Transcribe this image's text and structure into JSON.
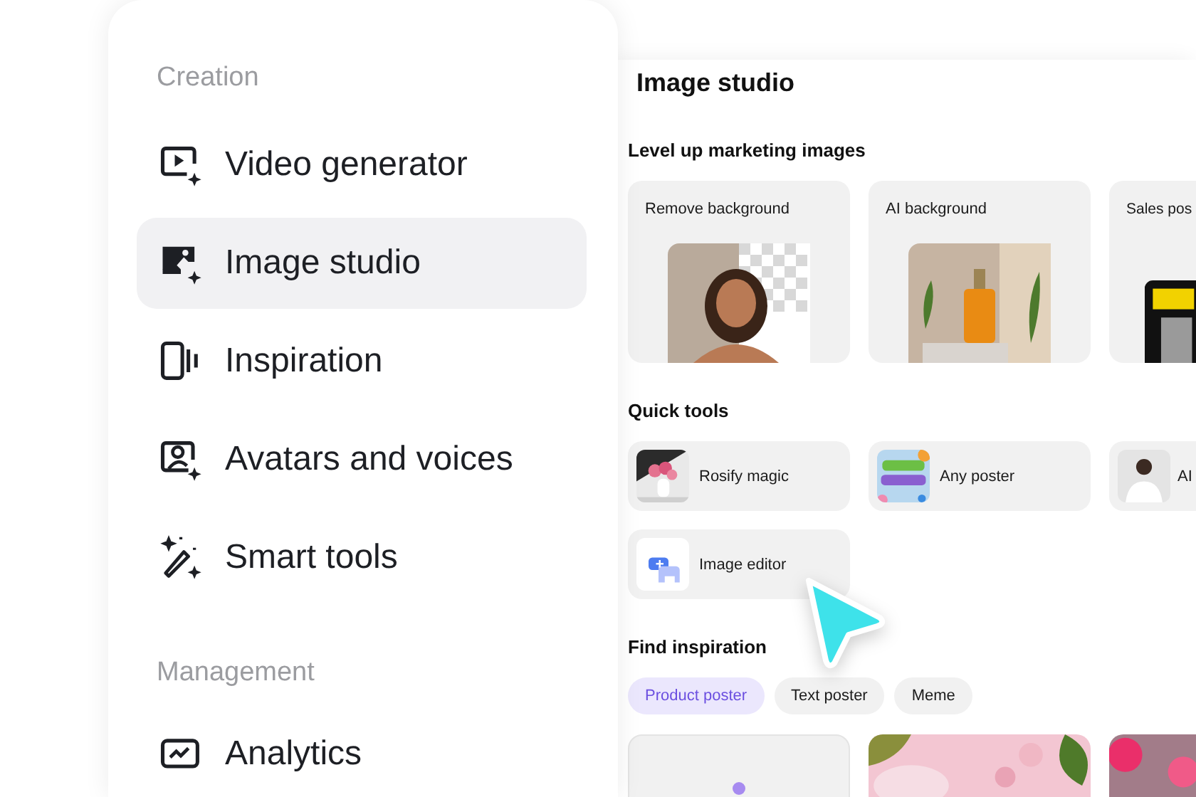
{
  "sidebar": {
    "sections": [
      {
        "heading": "Creation",
        "items": [
          {
            "label": "Video generator",
            "selected": false
          },
          {
            "label": "Image studio",
            "selected": true
          },
          {
            "label": "Inspiration",
            "selected": false
          },
          {
            "label": "Avatars and voices",
            "selected": false
          },
          {
            "label": "Smart tools",
            "selected": false
          }
        ]
      },
      {
        "heading": "Management",
        "items": [
          {
            "label": "Analytics",
            "selected": false
          }
        ]
      }
    ]
  },
  "panel": {
    "title": "Image studio",
    "marketing": {
      "heading": "Level up marketing images",
      "cards": [
        {
          "label": "Remove background"
        },
        {
          "label": "AI background"
        },
        {
          "label": "Sales pos"
        }
      ]
    },
    "quick_tools": {
      "heading": "Quick tools",
      "tools": [
        {
          "label": "Rosify magic"
        },
        {
          "label": "Any poster"
        },
        {
          "label": "AI"
        },
        {
          "label": "Image editor"
        }
      ]
    },
    "inspiration": {
      "heading": "Find inspiration",
      "filters": [
        {
          "label": "Product poster",
          "selected": true
        },
        {
          "label": "Text poster",
          "selected": false
        },
        {
          "label": "Meme",
          "selected": false
        }
      ],
      "cards": [
        {
          "kind": "blank"
        },
        {
          "kind": "picture"
        },
        {
          "kind": "picture"
        }
      ]
    }
  }
}
